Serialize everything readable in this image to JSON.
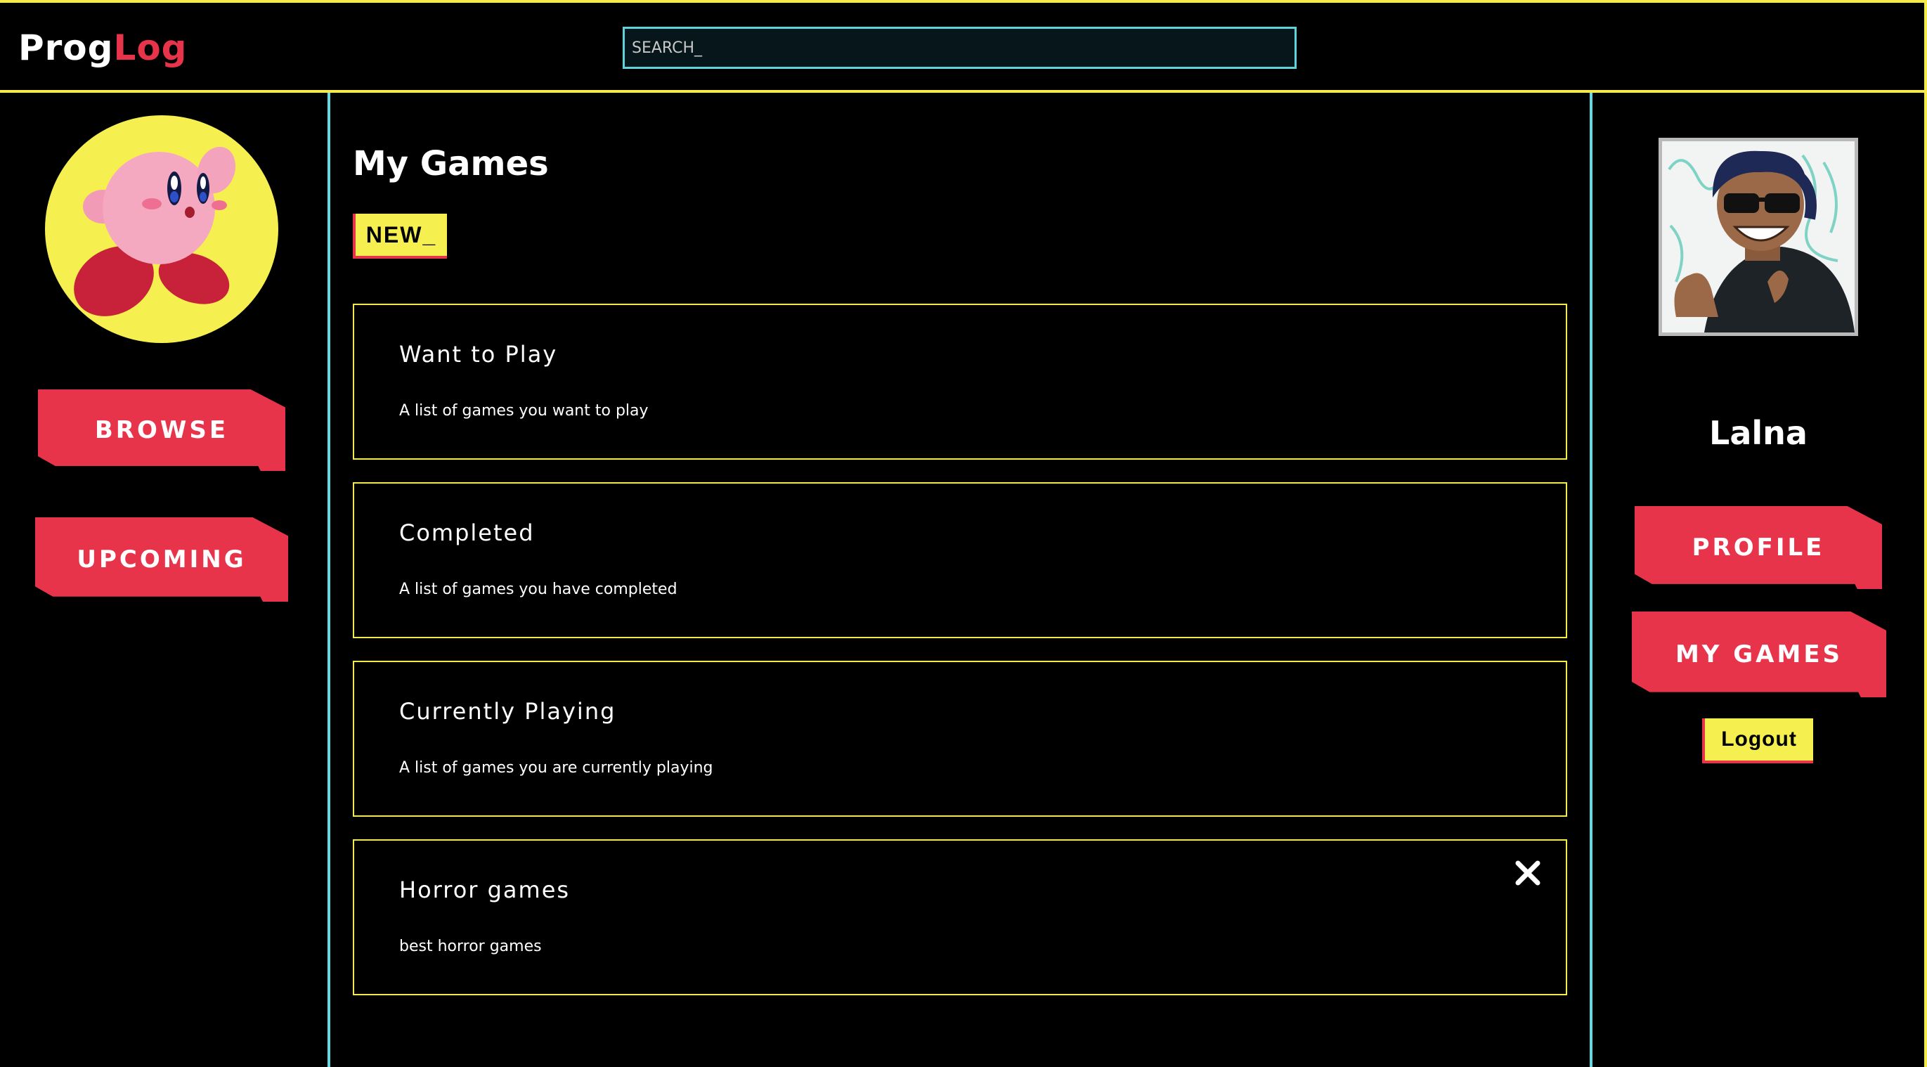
{
  "header": {
    "logo_part1": "Prog",
    "logo_part2": "Log",
    "search_placeholder": "SEARCH_"
  },
  "left_sidebar": {
    "browse_label": "BROWSE",
    "upcoming_label": "UPCOMING"
  },
  "main": {
    "title": "My Games",
    "new_label": "NEW_",
    "lists": [
      {
        "title": "Want to Play",
        "description": "A list of games you want to play"
      },
      {
        "title": "Completed",
        "description": "A list of games you have completed"
      },
      {
        "title": "Currently Playing",
        "description": "A list of games you are currently playing"
      },
      {
        "title": "Horror games",
        "description": "best horror games"
      }
    ]
  },
  "right_sidebar": {
    "username": "Lalna",
    "profile_label": "PROFILE",
    "my_games_label": "MY GAMES",
    "logout_label": "Logout"
  },
  "colors": {
    "accent_yellow": "#f5e94b",
    "accent_red": "#e8344a",
    "accent_cyan": "#6dd5de",
    "background": "#000000"
  },
  "icons": {
    "close": "close-icon"
  }
}
